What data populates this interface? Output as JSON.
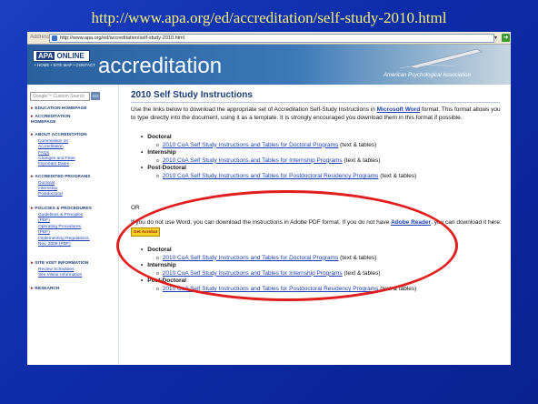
{
  "slide": {
    "url_title": "http://www.apa.org/ed/accreditation/self-study-2010.html"
  },
  "address_bar": {
    "label": "Address",
    "url": "http://www.apa.org/ed/accreditation/self-study-2010.html"
  },
  "banner": {
    "logo_a": "APA",
    "logo_b": "ONLINE",
    "nav": "• HOME  • SITE MAP  • CONTACT",
    "title": "accreditation",
    "subtitle": "American Psychological Association"
  },
  "sidebar": {
    "search_placeholder": "Google™ Custom Search",
    "search_button": "GO",
    "items": [
      {
        "label": "EDUCATION HOMEPAGE"
      },
      {
        "label": "ACCREDITATION HOMEPAGE"
      },
      {
        "label": "ABOUT ACCREDITATION"
      },
      {
        "label": "ACCREDITED PROGRAMS"
      },
      {
        "label": "POLICIES & PROCEDURES"
      },
      {
        "label": "SITE VISIT INFORMATION"
      },
      {
        "label": "RESEARCH"
      }
    ],
    "links": [
      "Commission on Accreditation",
      "FAQs",
      "Changes and Fees",
      "Important Dates",
      "Doctoral",
      "Internship",
      "Postdoctoral",
      "Guidelines & Principles (PDF)",
      "Operating Procedures (PDF)",
      "Implementing Regulations, Nov. 2008 (PDF)",
      "Review Schedules",
      "Site Visitor Information"
    ]
  },
  "content": {
    "title": "2010 Self Study Instructions",
    "intro_a": "Use the links below to download the appropriate set of Accreditation Self-Study Instructions in",
    "intro_word": "Microsoft Word",
    "intro_b": "format. This format allows you to type directly into the document, using it as a template. It is strongly encouraged you download them in this format if possible.",
    "section1": [
      {
        "category": "Doctoral",
        "link": "2010 CoA Self Study Instructions and Tables for Doctoral Programs",
        "suffix": "(text & tables)"
      },
      {
        "category": "Internship",
        "link": "2010 CoA Self Study Instructions and Tables for Internship Programs",
        "suffix": "(text & tables)"
      },
      {
        "category": "Post-Doctoral",
        "link": "2010 CoA Self Study Instructions and Tables for Postdoctoral Residency Programs",
        "suffix": "(text & tables)"
      }
    ],
    "or": "OR",
    "pdf_a": "If you do not use Word, you can download the instructions in Adobe PDF format. If you do not have",
    "pdf_link": "Adobe Reader",
    "pdf_b": ", you can download it here:",
    "get_button": "Get Acrobat",
    "section2": [
      {
        "category": "Doctoral",
        "link": "2010 CoA Self Study Instructions and Tables for Doctoral Programs",
        "suffix": "(text & tables)"
      },
      {
        "category": "Internship",
        "link": "2010 CoA Self Study Instructions and Tables for Internship Programs",
        "suffix": "(text & tables)"
      },
      {
        "category": "Post-Doctoral",
        "link": "2010 CoA Self Study Instructions and Tables for Postdoctoral Residency Programs",
        "suffix": "(text & tables)"
      }
    ]
  },
  "colors": {
    "slide_bg": "#0d2ca8",
    "slide_title": "#f4f07a",
    "highlight_oval": "#e01e1e",
    "link": "#1a3cb5",
    "heading": "#1c3f7a"
  }
}
